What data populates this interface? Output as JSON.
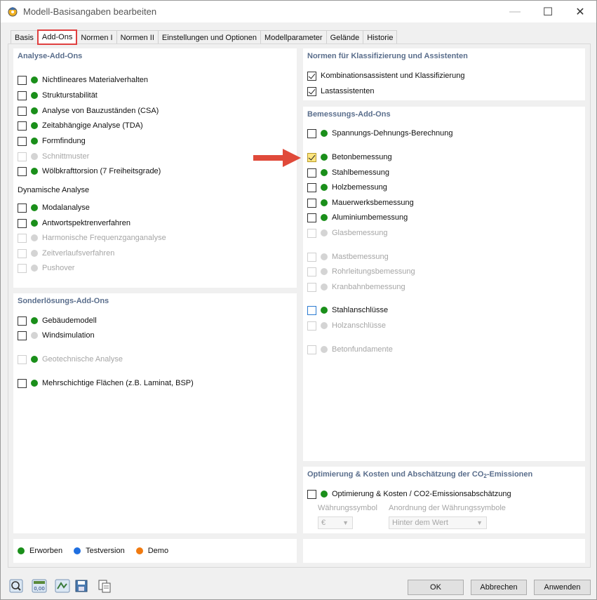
{
  "window": {
    "title": "Modell-Basisangaben bearbeiten",
    "controls": {
      "minimize": "—",
      "maximize": "☐",
      "close": "✕"
    }
  },
  "tabs": [
    {
      "label": "Basis",
      "active": false
    },
    {
      "label": "Add-Ons",
      "active": true
    },
    {
      "label": "Normen I",
      "active": false
    },
    {
      "label": "Normen II",
      "active": false
    },
    {
      "label": "Einstellungen und Optionen",
      "active": false
    },
    {
      "label": "Modellparameter",
      "active": false
    },
    {
      "label": "Gelände",
      "active": false
    },
    {
      "label": "Historie",
      "active": false
    }
  ],
  "analyse": {
    "title": "Analyse-Add-Ons",
    "items": [
      {
        "label": "Nichtlineares Materialverhalten",
        "status": "green",
        "enabled": true,
        "checked": false
      },
      {
        "label": "Strukturstabilität",
        "status": "green",
        "enabled": true,
        "checked": false
      },
      {
        "label": "Analyse von Bauzuständen (CSA)",
        "status": "green",
        "enabled": true,
        "checked": false
      },
      {
        "label": "Zeitabhängige Analyse (TDA)",
        "status": "green",
        "enabled": true,
        "checked": false
      },
      {
        "label": "Formfindung",
        "status": "green",
        "enabled": true,
        "checked": false
      },
      {
        "label": "Schnittmuster",
        "status": "grey",
        "enabled": false,
        "checked": false
      },
      {
        "label": "Wölbkrafttorsion (7 Freiheitsgrade)",
        "status": "green",
        "enabled": true,
        "checked": false
      }
    ],
    "dynamic_label": "Dynamische Analyse",
    "dynamic_items": [
      {
        "label": "Modalanalyse",
        "status": "green",
        "enabled": true,
        "checked": false
      },
      {
        "label": "Antwortspektrenverfahren",
        "status": "green",
        "enabled": true,
        "checked": false
      },
      {
        "label": "Harmonische Frequenzganganalyse",
        "status": "grey",
        "enabled": false,
        "checked": false
      },
      {
        "label": "Zeitverlaufsverfahren",
        "status": "grey",
        "enabled": false,
        "checked": false
      },
      {
        "label": "Pushover",
        "status": "grey",
        "enabled": false,
        "checked": false
      }
    ]
  },
  "sonder": {
    "title": "Sonderlösungs-Add-Ons",
    "items": [
      {
        "label": "Gebäudemodell",
        "status": "green",
        "enabled": true,
        "checked": false
      },
      {
        "label": "Windsimulation",
        "status": "grey",
        "enabled": true,
        "checked": false
      },
      {
        "label": "Geotechnische Analyse",
        "status": "green",
        "enabled": false,
        "checked": false
      },
      {
        "label": "Mehrschichtige Flächen (z.B. Laminat, BSP)",
        "status": "green",
        "enabled": true,
        "checked": false
      }
    ]
  },
  "normen": {
    "title": "Normen für Klassifizierung und Assistenten",
    "items": [
      {
        "label": "Kombinationsassistent und Klassifizierung",
        "checked": true
      },
      {
        "label": "Lastassistenten",
        "checked": true
      }
    ]
  },
  "bemessung": {
    "title": "Bemessungs-Add-Ons",
    "items": [
      {
        "label": "Spannungs-Dehnungs-Berechnung",
        "status": "green",
        "enabled": true,
        "checked": false
      },
      {
        "label": "Betonbemessung",
        "status": "green",
        "enabled": true,
        "checked": true
      },
      {
        "label": "Stahlbemessung",
        "status": "green",
        "enabled": true,
        "checked": false
      },
      {
        "label": "Holzbemessung",
        "status": "green",
        "enabled": true,
        "checked": false
      },
      {
        "label": "Mauerwerksbemessung",
        "status": "green",
        "enabled": true,
        "checked": false
      },
      {
        "label": "Aluminiumbemessung",
        "status": "green",
        "enabled": true,
        "checked": false
      },
      {
        "label": "Glasbemessung",
        "status": "grey",
        "enabled": false,
        "checked": false
      },
      {
        "label": "Mastbemessung",
        "status": "grey",
        "enabled": false,
        "checked": false
      },
      {
        "label": "Rohrleitungsbemessung",
        "status": "grey",
        "enabled": false,
        "checked": false
      },
      {
        "label": "Kranbahnbemessung",
        "status": "grey",
        "enabled": false,
        "checked": false
      },
      {
        "label": "Stahlanschlüsse",
        "status": "green",
        "enabled": true,
        "checked": false
      },
      {
        "label": "Holzanschlüsse",
        "status": "grey",
        "enabled": false,
        "checked": false
      },
      {
        "label": "Betonfundamente",
        "status": "grey",
        "enabled": false,
        "checked": false
      }
    ]
  },
  "optimierung": {
    "title_prefix": "Optimierung & Kosten und Abschätzung der CO",
    "title_sub": "2",
    "title_suffix": "-Emissionen",
    "item_label": "Optimierung & Kosten / CO2-Emissionsabschätzung",
    "currency_symbol_label": "Währungssymbol",
    "currency_symbol_value": "€",
    "currency_position_label": "Anordnung der Währungssymbole",
    "currency_position_value": "Hinter dem Wert"
  },
  "legend": [
    {
      "label": "Erworben",
      "color": "#1a8f1a"
    },
    {
      "label": "Testversion",
      "color": "#1f6fe0"
    },
    {
      "label": "Demo",
      "color": "#f07a10"
    }
  ],
  "toolbar_icons": [
    "help-icon",
    "units-icon",
    "model-icon",
    "save-icon",
    "copy-icon"
  ],
  "units_icon_text": "0,00",
  "buttons": {
    "ok": "OK",
    "cancel": "Abbrechen",
    "apply": "Anwenden"
  },
  "colors": {
    "accent_red": "#e04040",
    "section_title": "#5a6e8c",
    "acquired": "#1a8f1a"
  }
}
